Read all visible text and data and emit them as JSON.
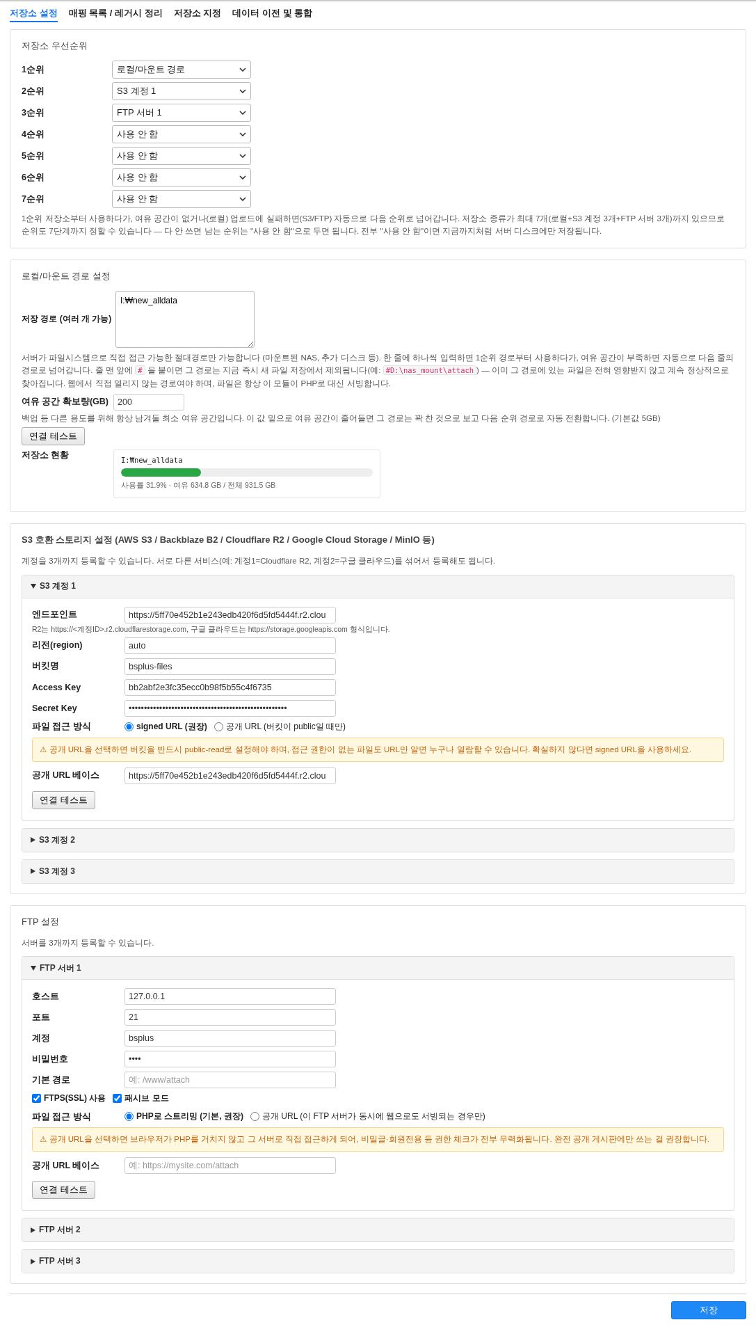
{
  "tabs": [
    {
      "label": "저장소 설정",
      "selected": true
    },
    {
      "label": "매핑 목록 / 레거시 정리",
      "selected": false
    },
    {
      "label": "저장소 지정",
      "selected": false
    },
    {
      "label": "데이터 이전 및 통합",
      "selected": false
    }
  ],
  "priority": {
    "title": "저장소 우선순위",
    "rows": [
      {
        "label": "1순위",
        "value": "로컬/마운트 경로"
      },
      {
        "label": "2순위",
        "value": "S3 계정 1"
      },
      {
        "label": "3순위",
        "value": "FTP 서버 1"
      },
      {
        "label": "4순위",
        "value": "사용 안 함"
      },
      {
        "label": "5순위",
        "value": "사용 안 함"
      },
      {
        "label": "6순위",
        "value": "사용 안 함"
      },
      {
        "label": "7순위",
        "value": "사용 안 함"
      }
    ],
    "note": "1순위 저장소부터 사용하다가, 여유 공간이 없거나(로컬) 업로드에 실패하면(S3/FTP) 자동으로 다음 순위로 넘어갑니다. 저장소 종류가 최대 7개(로컬+S3 계정 3개+FTP 서버 3개)까지 있으므로 순위도 7단계까지 정할 수 있습니다 — 다 안 쓰면 남는 순위는 \"사용 안 함\"으로 두면 됩니다. 전부 \"사용 안 함\"이면 지금까지처럼 서버 디스크에만 저장됩니다."
  },
  "local": {
    "title": "로컬/마운트 경로 설정",
    "path_label": "저장 경로 (여러 개 가능)",
    "path_value": "I:₩new_alldata",
    "help": [
      {
        "kind": "text",
        "text": "서버가 파일시스템으로 직접 접근 가능한 절대경로만 가능합니다 (마운트된 NAS, 추가 디스크 등). 한 줄에 하나씩 입력하면 1순위 경로부터 사용하다가, 여유 공간이 부족하면 자동으로 다음 줄의 경로로 넘어갑니다. 줄 맨 앞에 "
      },
      {
        "kind": "code",
        "text": "#"
      },
      {
        "kind": "text",
        "text": " 을 붙이면 그 경로는 지금 즉시 새 파일 저장에서 제외됩니다(예: "
      },
      {
        "kind": "code",
        "text": "#D:\\nas_mount\\attach"
      },
      {
        "kind": "text",
        "text": ") — 이미 그 경로에 있는 파일은 전혀 영향받지 않고 계속 정상적으로 찾아집니다. 웹에서 직접 열리지 않는 경로여야 하며, 파일은 항상 이 모듈이 PHP로 대신 서빙합니다."
      }
    ],
    "reserve_label": "여유 공간 확보량(GB)",
    "reserve_value": "200",
    "reserve_help": "백업 등 다른 용도를 위해 항상 남겨둘 최소 여유 공간입니다. 이 값 밑으로 여유 공간이 줄어들면 그 경로는 꽉 찬 것으로 보고 다음 순위 경로로 자동 전환합니다. (기본값 5GB)",
    "test_button": "연결 테스트",
    "status": {
      "label": "저장소 현황",
      "path": "I:₩new_alldata",
      "level": 0.319,
      "reading": "사용률 31.9% · 여유 634.8 GB / 전체 931.5 GB"
    }
  },
  "s3": {
    "title": "S3 호환 스토리지 설정 (AWS S3 / Backblaze B2 / Cloudflare R2 / Google Cloud Storage / MinIO 등)",
    "note": "계정을 3개까지 등록할 수 있습니다. 서로 다른 서비스(예: 계정1=Cloudflare R2, 계정2=구글 클라우드)를 섞어서 등록해도 됩니다.",
    "accounts": [
      {
        "title": "S3 계정 1",
        "expanded": true,
        "fields": [
          {
            "label": "엔드포인트",
            "value": "https://5ff70e452b1e243edb420f6d5fd5444f.r2.clou",
            "hint": "R2는 https://<계정ID>.r2.cloudflarestorage.com, 구글 클라우드는 https://storage.googleapis.com 형식입니다."
          },
          {
            "label": "리전(region)",
            "value": "auto"
          },
          {
            "label": "버킷명",
            "value": "bsplus-files"
          },
          {
            "label": "Access Key",
            "value": "bb2abf2e3fc35ecc0b98f5b55c4f6735"
          },
          {
            "label": "Secret Key",
            "value": "••••••••••••••••••••••••••••••••••••••••••••••••••••"
          }
        ],
        "access": {
          "label": "파일 접근 방식",
          "options": [
            {
              "label": "signed URL (권장)",
              "selected": true
            },
            {
              "label": "공개 URL (버킷이 public일 때만)",
              "selected": false
            }
          ]
        },
        "warning": "⚠ 공개 URL을 선택하면 버킷을 반드시 public-read로 설정해야 하며, 접근 권한이 없는 파일도 URL만 알면 누구나 열람할 수 있습니다. 확실하지 않다면 signed URL을 사용하세요.",
        "public_base": {
          "label": "공개 URL 베이스",
          "value": "https://5ff70e452b1e243edb420f6d5fd5444f.r2.clou"
        },
        "test_button": "연결 테스트"
      },
      {
        "title": "S3 계정 2",
        "expanded": false
      },
      {
        "title": "S3 계정 3",
        "expanded": false
      }
    ]
  },
  "ftp": {
    "title": "FTP 설정",
    "note": "서버를 3개까지 등록할 수 있습니다.",
    "accounts": [
      {
        "title": "FTP 서버 1",
        "expanded": true,
        "fields": [
          {
            "label": "호스트",
            "value": "127.0.0.1"
          },
          {
            "label": "포트",
            "value": "21"
          },
          {
            "label": "계정",
            "value": "bsplus"
          },
          {
            "label": "비밀번호",
            "value": "••••"
          },
          {
            "label": "기본 경로",
            "placeholder": "예: /www/attach"
          }
        ],
        "checkboxes": [
          {
            "label": "FTPS(SSL) 사용",
            "checked": true
          },
          {
            "label": "패시브 모드",
            "checked": true
          }
        ],
        "access": {
          "label": "파일 접근 방식",
          "options": [
            {
              "label": "PHP로 스트리밍 (기본, 권장)",
              "selected": true
            },
            {
              "label": "공개 URL (이 FTP 서버가 동시에 웹으로도 서빙되는 경우만)",
              "selected": false
            }
          ]
        },
        "warning": "⚠ 공개 URL을 선택하면 브라우저가 PHP를 거치지 않고 그 서버로 직접 접근하게 되어, 비밀글·회원전용 등 권한 체크가 전부 무력화됩니다. 완전 공개 게시판에만 쓰는 걸 권장합니다.",
        "public_base": {
          "label": "공개 URL 베이스",
          "placeholder": "예: https://mysite.com/attach"
        },
        "test_button": "연결 테스트"
      },
      {
        "title": "FTP 서버 2",
        "expanded": false
      },
      {
        "title": "FTP 서버 3",
        "expanded": false
      }
    ]
  },
  "save_button": "저장"
}
